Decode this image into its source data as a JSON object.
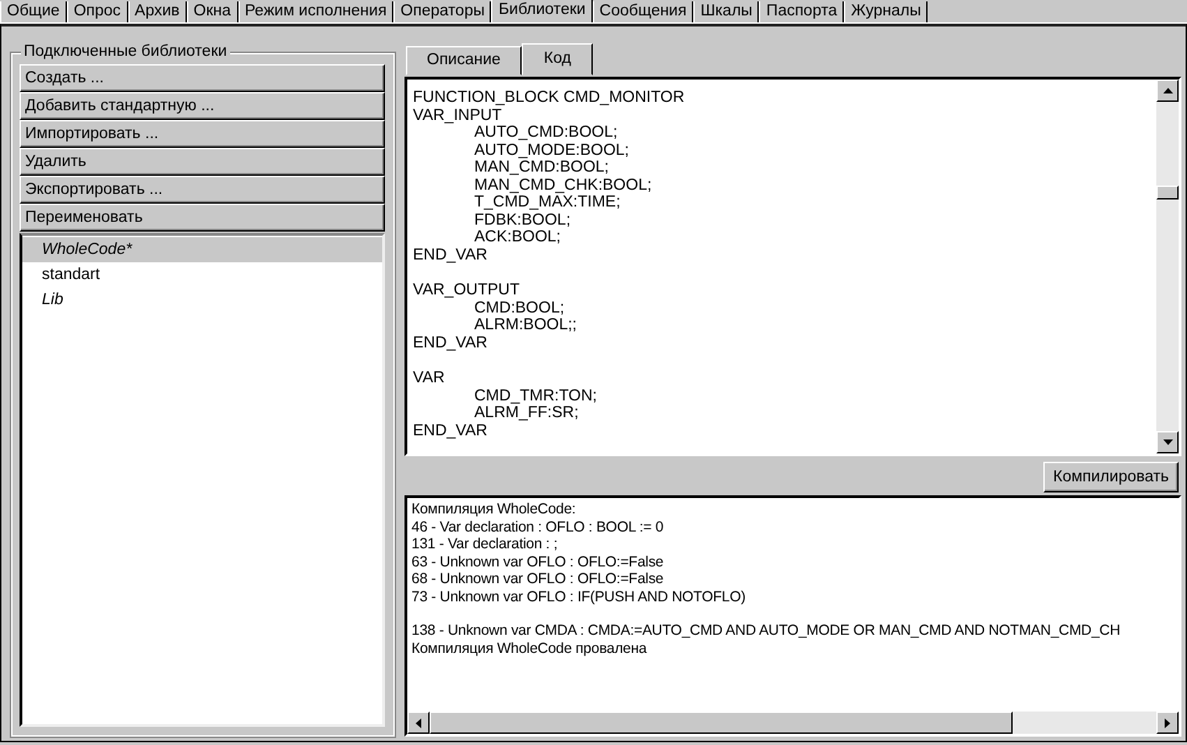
{
  "top_tabs": [
    {
      "label": "Общие",
      "selected": false
    },
    {
      "label": "Опрос",
      "selected": false
    },
    {
      "label": "Архив",
      "selected": false
    },
    {
      "label": "Окна",
      "selected": false
    },
    {
      "label": "Режим исполнения",
      "selected": false
    },
    {
      "label": "Операторы",
      "selected": false
    },
    {
      "label": "Библиотеки",
      "selected": true
    },
    {
      "label": "Сообщения",
      "selected": false
    },
    {
      "label": "Шкалы",
      "selected": false
    },
    {
      "label": "Паспорта",
      "selected": false
    },
    {
      "label": "Журналы",
      "selected": false
    }
  ],
  "libraries": {
    "title": "Подключенные библиотеки",
    "buttons": [
      "Создать ...",
      "Добавить стандартную ...",
      "Импортировать ...",
      "Удалить",
      "Экспортировать ...",
      "Переименовать"
    ],
    "items": [
      {
        "name": "WholeCode*",
        "italic": true,
        "selected": true
      },
      {
        "name": "standart",
        "italic": false,
        "selected": false
      },
      {
        "name": "Lib",
        "italic": true,
        "selected": false
      }
    ]
  },
  "editor_tabs": [
    {
      "label": "Описание",
      "selected": false
    },
    {
      "label": "Код",
      "selected": true
    }
  ],
  "code_blocks": [
    [
      {
        "text": "FUNCTION_BLOCK CMD_MONITOR",
        "indented": false
      },
      {
        "text": "VAR_INPUT",
        "indented": false
      },
      {
        "text": "AUTO_CMD:BOOL;",
        "indented": true
      },
      {
        "text": "AUTO_MODE:BOOL;",
        "indented": true
      },
      {
        "text": "MAN_CMD:BOOL;",
        "indented": true
      },
      {
        "text": "MAN_CMD_CHK:BOOL;",
        "indented": true
      },
      {
        "text": "T_CMD_MAX:TIME;",
        "indented": true
      },
      {
        "text": "FDBK:BOOL;",
        "indented": true
      },
      {
        "text": "ACK:BOOL;",
        "indented": true
      },
      {
        "text": "END_VAR",
        "indented": false
      }
    ],
    [
      {
        "text": "VAR_OUTPUT",
        "indented": false
      },
      {
        "text": "CMD:BOOL;",
        "indented": true
      },
      {
        "text": "ALRM:BOOL;;",
        "indented": true
      },
      {
        "text": "END_VAR",
        "indented": false
      }
    ],
    [
      {
        "text": "VAR",
        "indented": false
      },
      {
        "text": "CMD_TMR:TON;",
        "indented": true
      },
      {
        "text": "ALRM_FF:SR;",
        "indented": true
      },
      {
        "text": "END_VAR",
        "indented": false
      }
    ]
  ],
  "compile_button": "Компилировать",
  "output_blocks": [
    [
      "Компиляция WholeCode:",
      "46 - Var declaration : OFLO : BOOL := 0",
      "131 - Var declaration : ;",
      "63 - Unknown var OFLO : OFLO:=False",
      "68 - Unknown var OFLO : OFLO:=False",
      "73 - Unknown var OFLO : IF(PUSH AND NOTOFLO)"
    ],
    [
      "138 - Unknown var CMDA : CMDA:=AUTO_CMD AND AUTO_MODE OR MAN_CMD AND NOTMAN_CMD_CH",
      "Компиляция WholeCode провалена"
    ]
  ]
}
